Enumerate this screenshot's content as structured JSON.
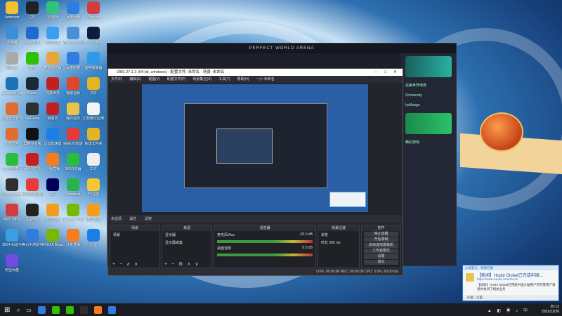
{
  "desktop_icons": [
    {
      "label": "Administr",
      "color": "#f1c232"
    },
    {
      "label": "QQ",
      "color": "#222"
    },
    {
      "label": "QQ音乐",
      "color": "#31c27c"
    },
    {
      "label": "百度网盘",
      "color": "#2f7de1"
    },
    {
      "label": "Windows",
      "color": "#d23c3c"
    },
    {
      "label": "此电脑",
      "color": "#3a8fd8"
    },
    {
      "label": "网易有道",
      "color": "#1b6bd1"
    },
    {
      "label": "迅雷影音",
      "color": "#38a0ef"
    },
    {
      "label": "Windows 照片查看",
      "color": "#4a90d9"
    },
    {
      "label": "Photoshop",
      "color": "#0b1f3a"
    },
    {
      "label": "回收站",
      "color": "#aaa"
    },
    {
      "label": "微信",
      "color": "#2dc100"
    },
    {
      "label": "搜狗浏览器",
      "color": "#e8a53a"
    },
    {
      "label": "百度网盘",
      "color": "#2f7de1"
    },
    {
      "label": "雷神加速器",
      "color": "#2d9ae8"
    },
    {
      "label": "Microsoft Edge",
      "color": "#1a73b5"
    },
    {
      "label": "Steam",
      "color": "#1b2838"
    },
    {
      "label": "完美世界",
      "color": "#c41e1e"
    },
    {
      "label": "有趣视频",
      "color": "#e0462a"
    },
    {
      "label": "文件",
      "color": "#e6b422"
    },
    {
      "label": "火绒安全软件",
      "color": "#e26b2d"
    },
    {
      "label": "WeGame",
      "color": "#2e2e2e"
    },
    {
      "label": "网易云",
      "color": "#c31f1f"
    },
    {
      "label": "我的任务",
      "color": "#e9c44a"
    },
    {
      "label": "幻想精灵应用",
      "color": "#f4f4f4"
    },
    {
      "label": "火绒安全",
      "color": "#e26b2d"
    },
    {
      "label": "剪映专业版",
      "color": "#111"
    },
    {
      "label": "迅雷加速器",
      "color": "#1d7ee8"
    },
    {
      "label": "网易UU加速",
      "color": "#e83a3a"
    },
    {
      "label": "新建文件夹",
      "color": "#e6b422"
    },
    {
      "label": "360安全卫士",
      "color": "#2dbb3c"
    },
    {
      "label": "网易云音乐",
      "color": "#c31f1f"
    },
    {
      "label": "斗鱼直播",
      "color": "#f57c1f"
    },
    {
      "label": "360浏览器",
      "color": "#2dbb3c"
    },
    {
      "label": "工作",
      "color": "#eee"
    },
    {
      "label": "OBS Studio",
      "color": "#302e31"
    },
    {
      "label": "网易UU加速器",
      "color": "#e83a3a"
    },
    {
      "label": "AE",
      "color": "#00005b"
    },
    {
      "label": "Camtasia",
      "color": "#2ab24c"
    },
    {
      "label": "YY语音",
      "color": "#f6c731"
    },
    {
      "label": "WPS Office",
      "color": "#d23c3c"
    },
    {
      "label": "鸟蛋电影",
      "color": "#222"
    },
    {
      "label": "虎牙直播",
      "color": "#f69c1d"
    },
    {
      "label": "GeForce Experience",
      "color": "#76b900"
    },
    {
      "label": "虎牙直播",
      "color": "#f69c1d"
    },
    {
      "label": "360手机助手",
      "color": "#3aa0e0"
    },
    {
      "label": "腾讯手游助手",
      "color": "#2f7de1"
    },
    {
      "label": "NVIDIA Broadcast",
      "color": "#76b900"
    },
    {
      "label": "斗鱼直播",
      "color": "#f57c1f"
    },
    {
      "label": "迅雷",
      "color": "#1d7ee8"
    },
    {
      "label": "阿里网盘",
      "color": "#6d4ee0"
    }
  ],
  "game_window": {
    "title": "PERFECT WORLD ARENA",
    "side_items": [
      "完美世界电竞",
      "Scoooooty",
      "hyMango",
      "精彩游戏"
    ]
  },
  "obs": {
    "title": "OBS 27.1.3 (64-bit, windows) - 配置文件: 未命名 - 场景: 未命名",
    "menu": [
      "文件(F)",
      "编辑(E)",
      "视图(V)",
      "配置文件(P)",
      "场景集合(S)",
      "工具(T)",
      "帮助(H)",
      "一小 未命名"
    ],
    "status": {
      "source": "未选源",
      "props": "属性",
      "filters": "滤镜"
    },
    "docks": {
      "scenes": {
        "title": "场景",
        "items": [
          "场景"
        ]
      },
      "sources": {
        "title": "来源",
        "items": [
          "显示器",
          "显示器采集"
        ]
      },
      "mixer": {
        "title": "混音器",
        "tracks": [
          "麦克风/Aux",
          "桌面音频"
        ],
        "db": [
          "-20.0 dB",
          "0.0 dB"
        ]
      },
      "transitions": {
        "title": "场景过渡",
        "type": "渐变",
        "duration_label": "时长",
        "duration": "300 ms"
      },
      "controls": {
        "title": "控件",
        "buttons": [
          "停止直播",
          "开始录制",
          "启动虚拟摄像机",
          "工作室模式",
          "设置",
          "退出"
        ]
      }
    },
    "footer": "LIVE: 00:00:00   REC: 00:00:00   CPU: 5.9%, 60.00 fps"
  },
  "notification": {
    "header": "火绒安全 · 弹窗拦截",
    "title": "【新闻】Huobi Global已完成中国...",
    "link": "https://www.huobi.com/zh-cn/",
    "body": "【新闻】Huobi Global已完成中国大陆用户的存量用户清退并关闭了相关业务",
    "footer": "拦截 · 设置"
  },
  "taskbar": {
    "time": "20:12",
    "date": "2021/12/26",
    "apps": [
      "#2f7de1",
      "#2dc100",
      "#2dc100",
      "#302e31",
      "#f57c1f",
      "#2f7de1"
    ]
  }
}
